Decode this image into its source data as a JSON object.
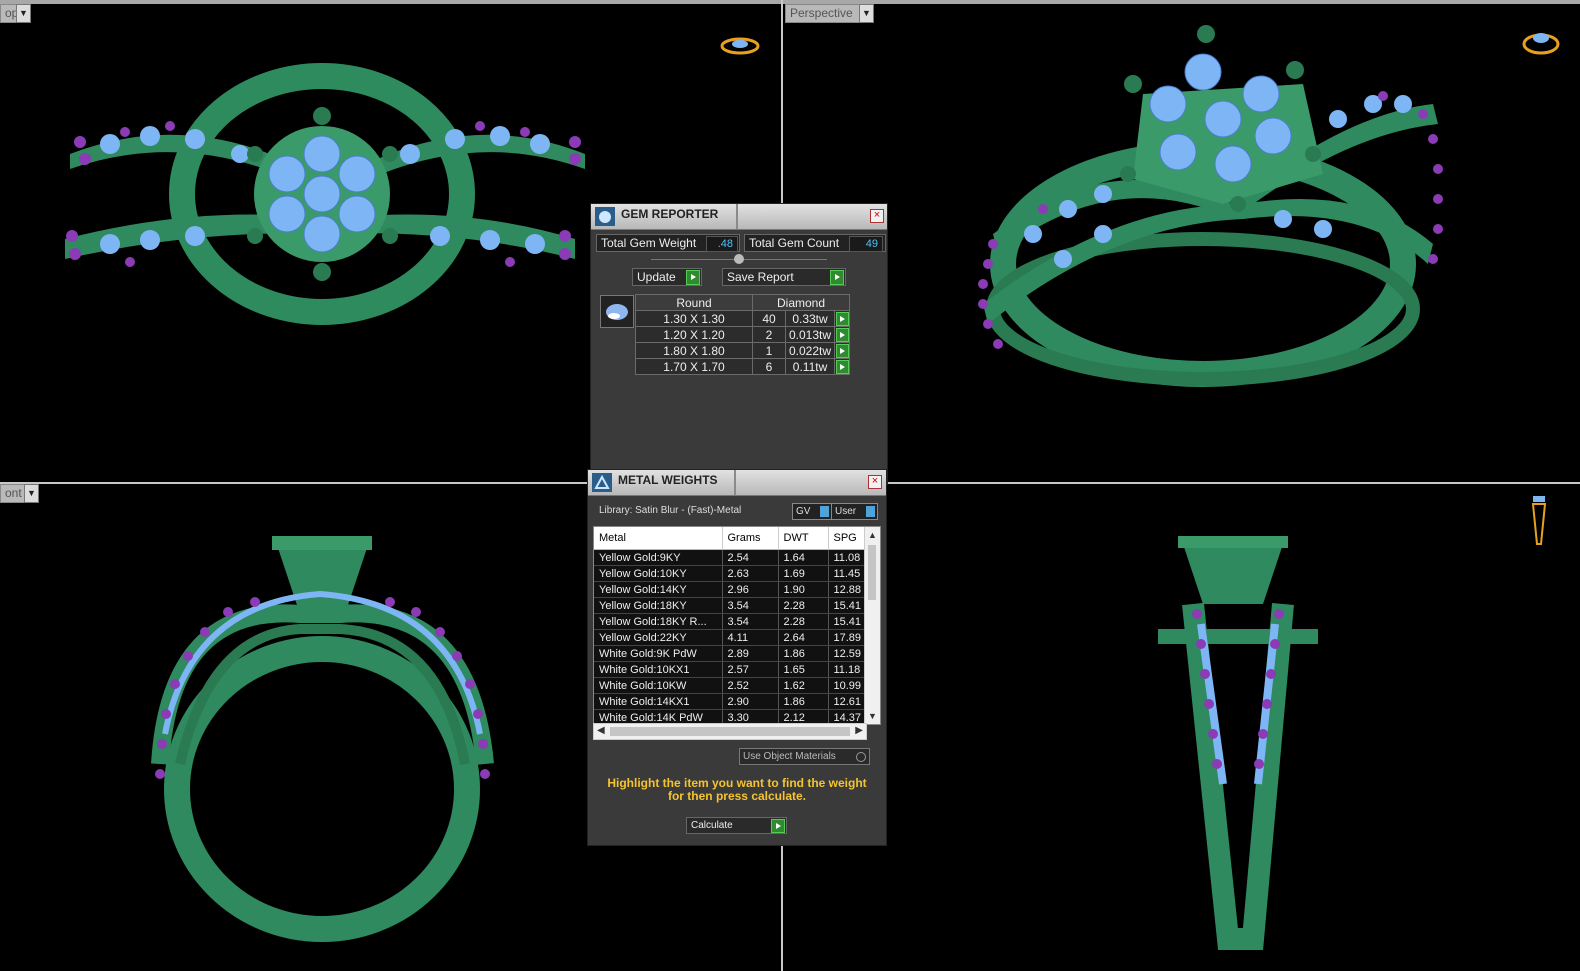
{
  "viewports": {
    "top_left": {
      "label": "op"
    },
    "top_right": {
      "label": "Perspective"
    },
    "bottom_left": {
      "label": "ont"
    }
  },
  "gem_reporter": {
    "title": "GEM REPORTER",
    "total_gem_weight_label": "Total Gem Weight",
    "total_gem_weight_value": ".48",
    "total_gem_count_label": "Total Gem Count",
    "total_gem_count_value": "49",
    "update_label": "Update",
    "save_report_label": "Save Report",
    "table_headers": [
      "Round",
      "Diamond"
    ],
    "rows": [
      {
        "size": "1.30 X 1.30",
        "count": "40",
        "weight": "0.33tw"
      },
      {
        "size": "1.20 X 1.20",
        "count": "2",
        "weight": "0.013tw"
      },
      {
        "size": "1.80 X 1.80",
        "count": "1",
        "weight": "0.022tw"
      },
      {
        "size": "1.70 X 1.70",
        "count": "6",
        "weight": "0.11tw"
      }
    ]
  },
  "metal_weights": {
    "title": "METAL WEIGHTS",
    "library_label": "Library: Satin Blur - (Fast)-Metal",
    "gv_label": "GV",
    "user_label": "User",
    "columns": [
      "Metal",
      "Grams",
      "DWT",
      "SPG"
    ],
    "rows": [
      [
        "Yellow Gold:9KY",
        "2.54",
        "1.64",
        "11.08"
      ],
      [
        "Yellow Gold:10KY",
        "2.63",
        "1.69",
        "11.45"
      ],
      [
        "Yellow Gold:14KY",
        "2.96",
        "1.90",
        "12.88"
      ],
      [
        "Yellow Gold:18KY",
        "3.54",
        "2.28",
        "15.41"
      ],
      [
        "Yellow Gold:18KY R...",
        "3.54",
        "2.28",
        "15.41"
      ],
      [
        "Yellow Gold:22KY",
        "4.11",
        "2.64",
        "17.89"
      ],
      [
        "White Gold:9K PdW",
        "2.89",
        "1.86",
        "12.59"
      ],
      [
        "White Gold:10KX1",
        "2.57",
        "1.65",
        "11.18"
      ],
      [
        "White Gold:10KW",
        "2.52",
        "1.62",
        "10.99"
      ],
      [
        "White Gold:14KX1",
        "2.90",
        "1.86",
        "12.61"
      ],
      [
        "White Gold:14K PdW",
        "3.30",
        "2.12",
        "14.37"
      ]
    ],
    "use_object_materials_label": "Use Object Materials",
    "hint_line1": "Highlight the item you want to find the weight",
    "hint_line2": "for then press calculate.",
    "calculate_label": "Calculate"
  }
}
